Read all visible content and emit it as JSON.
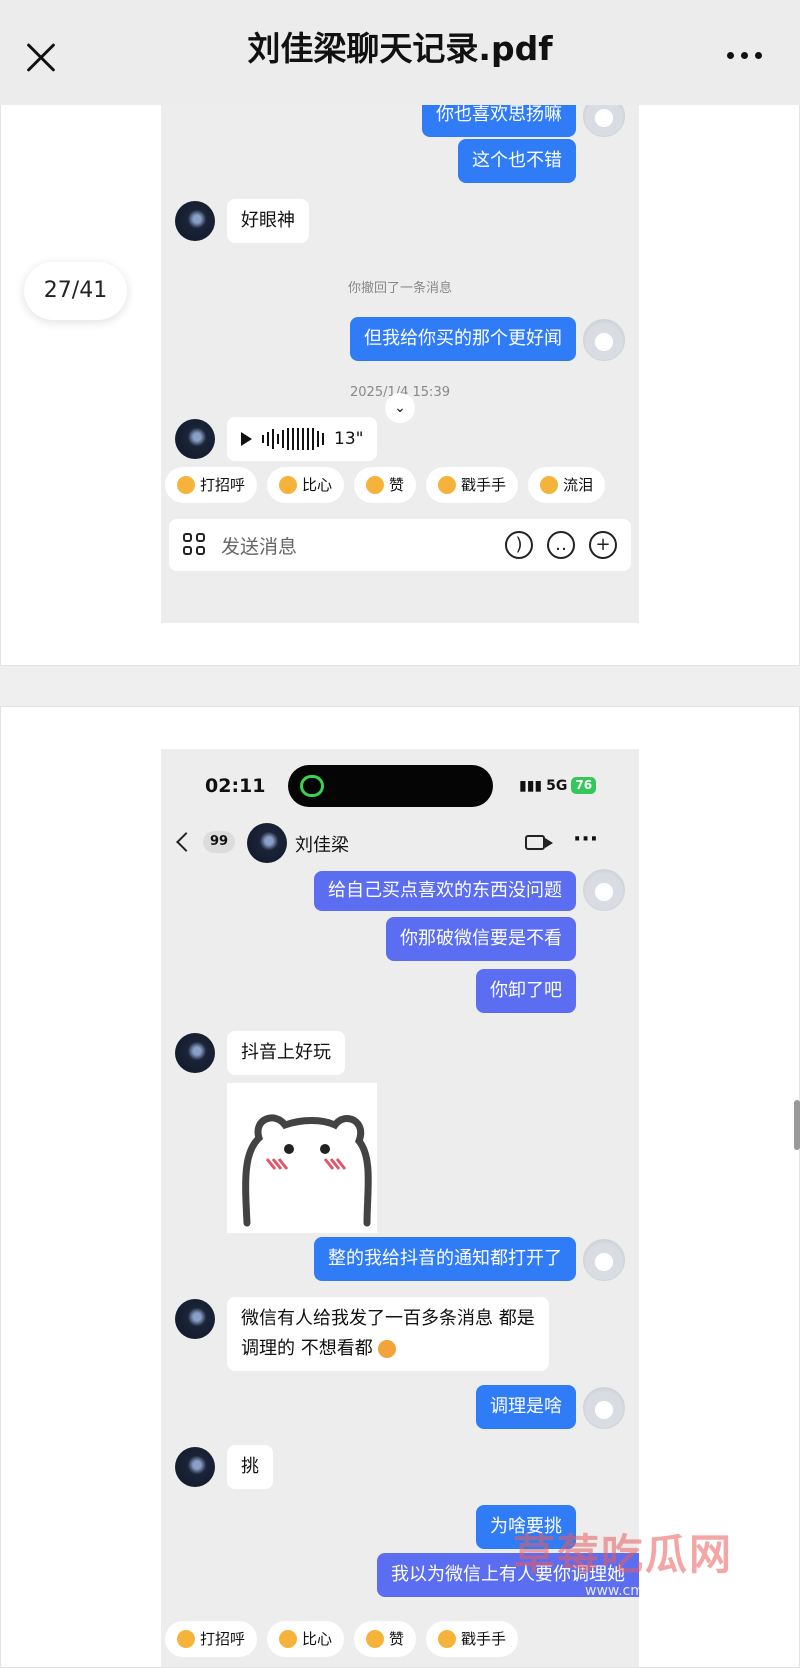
{
  "header": {
    "title": "刘佳梁聊天记录.pdf"
  },
  "page_indicator": "27/41",
  "page1": {
    "messages": [
      {
        "dir": "out",
        "text": "你也喜欢思扬嘛"
      },
      {
        "dir": "out",
        "text": "这个也不错"
      },
      {
        "dir": "in",
        "text": "好眼神"
      },
      {
        "dir": "out",
        "text": "但我给你买的那个更好闻"
      }
    ],
    "system_recall": "你撤回了一条消息",
    "timestamp": "2025/1/4 15:39",
    "voice_duration": "13\"",
    "quick_replies": [
      "打招呼",
      "比心",
      "赞",
      "戳手手",
      "流泪"
    ],
    "input_placeholder": "发送消息"
  },
  "page2": {
    "status": {
      "time": "02:11",
      "network": "5G",
      "battery": "76"
    },
    "chat_header": {
      "unread": "99",
      "name": "刘佳梁"
    },
    "messages": [
      {
        "dir": "out",
        "text": "给自己买点喜欢的东西没问题"
      },
      {
        "dir": "out",
        "text": "你那破微信要是不看"
      },
      {
        "dir": "out",
        "text": "你卸了吧"
      },
      {
        "dir": "in",
        "text": "抖音上好玩"
      },
      {
        "dir": "out",
        "text": "整的我给抖音的通知都打开了"
      },
      {
        "dir": "in",
        "text": "微信有人给我发了一百多条消息 都是"
      },
      {
        "dir": "in",
        "text": "调理的 不想看都"
      },
      {
        "dir": "out",
        "text": "调理是啥"
      },
      {
        "dir": "in",
        "text": "挑"
      },
      {
        "dir": "out",
        "text": "为啥要挑"
      },
      {
        "dir": "out",
        "text": "我以为微信上有人要你调理她"
      }
    ],
    "quick_replies": [
      "打招呼",
      "比心",
      "赞",
      "戳手手"
    ]
  },
  "watermark": {
    "name": "草莓吃瓜网",
    "url": "www.cmcgw.com"
  }
}
